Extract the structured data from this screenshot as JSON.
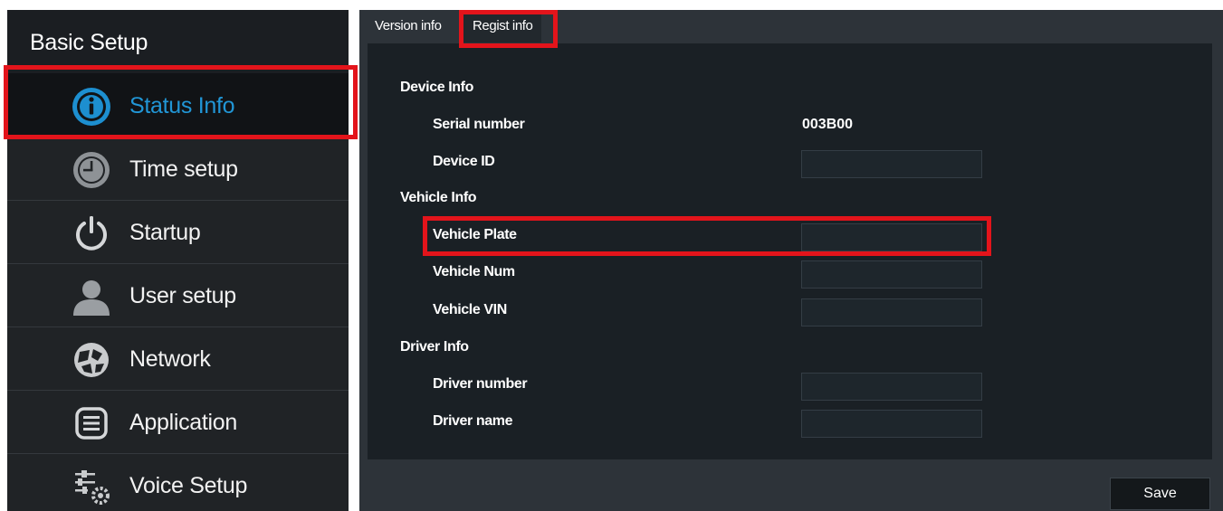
{
  "sidebar": {
    "title": "Basic Setup",
    "items": [
      {
        "label": "Status Info",
        "icon": "info-icon",
        "active": true
      },
      {
        "label": "Time setup",
        "icon": "clock-icon"
      },
      {
        "label": "Startup",
        "icon": "power-icon"
      },
      {
        "label": "User setup",
        "icon": "user-icon"
      },
      {
        "label": "Network",
        "icon": "network-icon"
      },
      {
        "label": "Application",
        "icon": "application-icon"
      },
      {
        "label": "Voice Setup",
        "icon": "voice-settings-icon"
      }
    ]
  },
  "tabs": [
    {
      "label": "Version info"
    },
    {
      "label": "Regist info",
      "active": true
    }
  ],
  "sections": {
    "device": {
      "title": "Device Info",
      "serial_label": "Serial number",
      "serial_value": "003B00",
      "device_id_label": "Device ID",
      "device_id_value": ""
    },
    "vehicle": {
      "title": "Vehicle Info",
      "plate_label": "Vehicle Plate",
      "plate_value": "",
      "num_label": "Vehicle Num",
      "num_value": "",
      "vin_label": "Vehicle VIN",
      "vin_value": ""
    },
    "driver": {
      "title": "Driver Info",
      "number_label": "Driver number",
      "number_value": "",
      "name_label": "Driver name",
      "name_value": ""
    }
  },
  "actions": {
    "save_label": "Save"
  },
  "colors": {
    "accent": "#2196d6",
    "highlight": "#e3141b",
    "sidebar_bg": "#1b1e22",
    "panel_bg": "#2d3339",
    "content_bg": "#1a2025"
  }
}
